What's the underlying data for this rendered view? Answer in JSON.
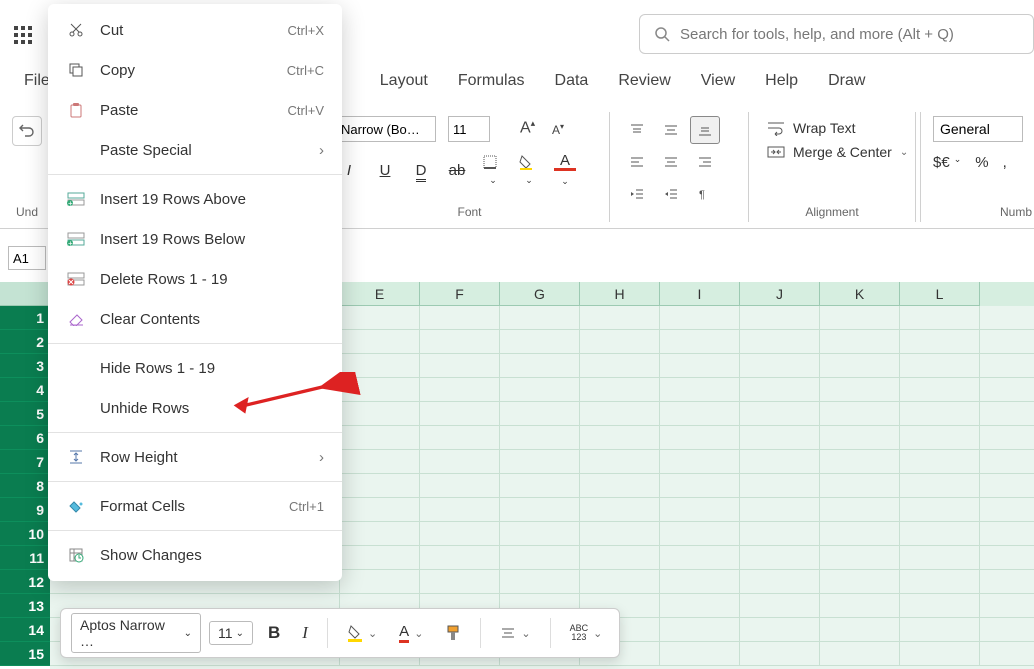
{
  "app_launcher": "app-launcher",
  "menu": {
    "file": "File",
    "layout": "Layout",
    "formulas": "Formulas",
    "data": "Data",
    "review": "Review",
    "view": "View",
    "help": "Help",
    "draw": "Draw"
  },
  "search": {
    "placeholder": "Search for tools, help, and more (Alt + Q)"
  },
  "ribbon": {
    "undo_label": "Und",
    "font": {
      "name": "Narrow (Bo…",
      "size": "11",
      "label": "Font"
    },
    "alignment": {
      "wrap": "Wrap Text",
      "merge": "Merge & Center",
      "label": "Alignment"
    },
    "number": {
      "format": "General",
      "currency": "$€",
      "percent": "%",
      "label": "Numb"
    }
  },
  "name_box": "A1",
  "columns": [
    "",
    "E",
    "F",
    "G",
    "H",
    "I",
    "J",
    "K",
    "L"
  ],
  "rows": [
    "1",
    "2",
    "3",
    "4",
    "5",
    "6",
    "7",
    "8",
    "9",
    "10",
    "11",
    "12",
    "13",
    "14",
    "15"
  ],
  "mini": {
    "font": "Aptos Narrow …",
    "size": "11",
    "abc": "ABC\n123"
  },
  "context": {
    "cut": {
      "label": "Cut",
      "shortcut": "Ctrl+X"
    },
    "copy": {
      "label": "Copy",
      "shortcut": "Ctrl+C"
    },
    "paste": {
      "label": "Paste",
      "shortcut": "Ctrl+V"
    },
    "paste_special": {
      "label": "Paste Special"
    },
    "insert_above": {
      "label": "Insert 19 Rows Above"
    },
    "insert_below": {
      "label": "Insert 19 Rows Below"
    },
    "delete_rows": {
      "label": "Delete Rows 1 - 19"
    },
    "clear": {
      "label": "Clear Contents"
    },
    "hide": {
      "label": "Hide Rows 1 - 19"
    },
    "unhide": {
      "label": "Unhide Rows"
    },
    "row_height": {
      "label": "Row Height"
    },
    "format_cells": {
      "label": "Format Cells",
      "shortcut": "Ctrl+1"
    },
    "show_changes": {
      "label": "Show Changes"
    }
  }
}
